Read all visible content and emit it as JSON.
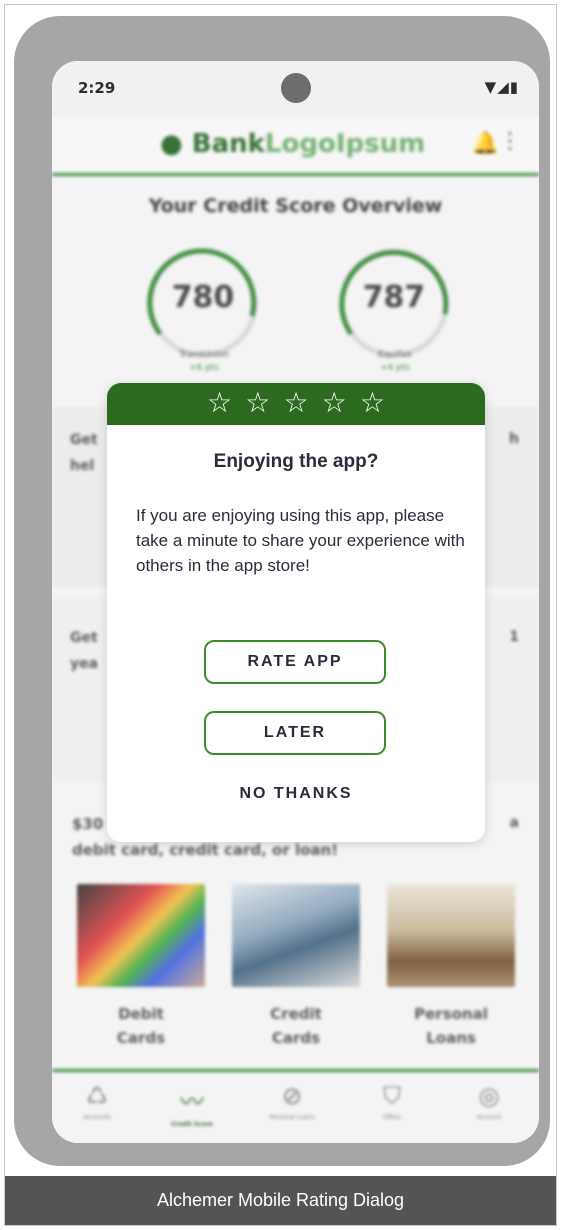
{
  "status_bar": {
    "time": "2:29",
    "icons": "▼◢▮"
  },
  "app": {
    "logo_part1": "Bank",
    "logo_part2": "LogoIpsum",
    "section_title": "Your Credit Score Overview",
    "scores": [
      {
        "value": "780",
        "bureau": "TransUnion",
        "change": "+6 pts"
      },
      {
        "value": "787",
        "bureau": "Equifax",
        "change": "+4 pts"
      }
    ],
    "band1_left": "Get",
    "band1_left2": "hel",
    "band1_right": "h",
    "band2_left": "Get",
    "band2_left2": "yea",
    "band2_right": "1",
    "offer_line1_left": "$30",
    "offer_line1_right": "a",
    "offer_line2": "debit card, credit card, or loan!",
    "products": [
      {
        "label_line1": "Debit",
        "label_line2": "Cards"
      },
      {
        "label_line1": "Credit",
        "label_line2": "Cards"
      },
      {
        "label_line1": "Personal",
        "label_line2": "Loans"
      }
    ],
    "nav": [
      {
        "icon": "accounts-icon",
        "label": "Accounts"
      },
      {
        "icon": "credit-score-icon",
        "label": "Credit Score"
      },
      {
        "icon": "personal-loans-icon",
        "label": "Personal Loans"
      },
      {
        "icon": "offers-icon",
        "label": "Offers"
      },
      {
        "icon": "account-icon",
        "label": "Account"
      }
    ]
  },
  "dialog": {
    "stars": [
      "☆",
      "☆",
      "☆",
      "☆",
      "☆"
    ],
    "title": "Enjoying the app?",
    "body": "If you are enjoying using this app, please take a minute to share your experience with others in the app store!",
    "rate_label": "RATE APP",
    "later_label": "LATER",
    "no_thanks_label": "NO THANKS"
  },
  "caption": "Alchemer Mobile Rating Dialog",
  "colors": {
    "brand_green": "#2c6a1f",
    "button_border": "#3f8a2d",
    "caption_bg": "#545454"
  }
}
